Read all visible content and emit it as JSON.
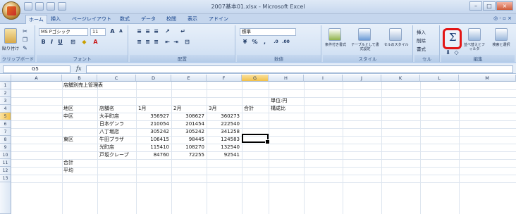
{
  "window": {
    "title": "2007基本01.xlsx - Microsoft Excel",
    "controls": [
      "–",
      "□",
      "×"
    ]
  },
  "ribbon_tabs": [
    "ホーム",
    "挿入",
    "ページレイアウト",
    "数式",
    "データ",
    "校閲",
    "表示",
    "アドイン"
  ],
  "ribbon_tabs_right": "◎ - ▫ ×",
  "ribbon": {
    "clipboard": {
      "paste_label": "貼り付け",
      "group_label": "クリップボード"
    },
    "font": {
      "font_name": "MS Pゴシック",
      "font_size": "11",
      "group_label": "フォント"
    },
    "alignment": {
      "group_label": "配置"
    },
    "number": {
      "format": "標準",
      "group_label": "数値"
    },
    "styles": {
      "conditional": "条件付き書式",
      "table": "テーブルとして書式設定",
      "cell_styles": "セルのスタイル",
      "group_label": "スタイル"
    },
    "cells": {
      "insert": "挿入",
      "delete": "削除",
      "format": "書式",
      "group_label": "セル"
    },
    "editing": {
      "autosum": "Σ",
      "sort": "並べ替えとフィルタ",
      "find": "検索と選択",
      "group_label": "編集"
    }
  },
  "formula_bar": {
    "name_box": "G5",
    "fx": "fx",
    "formula": ""
  },
  "sheet": {
    "columns": [
      "A",
      "B",
      "C",
      "D",
      "E",
      "F",
      "G",
      "H",
      "I",
      "J",
      "K",
      "L",
      "M"
    ],
    "selected_column": "G",
    "rows": [
      "1",
      "2",
      "3",
      "4",
      "5",
      "6",
      "7",
      "8",
      "9",
      "10",
      "11",
      "12",
      "13"
    ],
    "selected_row": "5",
    "title": "店舗別売上管理表",
    "unit_label": "単位:円",
    "headers": {
      "area": "地区",
      "store": "店舗名",
      "m1": "1月",
      "m2": "2月",
      "m3": "3月",
      "total": "合計",
      "ratio": "構成比"
    },
    "data_rows": [
      {
        "area": "中区",
        "store": "大手町店",
        "m1": "356927",
        "m2": "308627",
        "m3": "360273"
      },
      {
        "area": "",
        "store": "日本ゲンラ",
        "m1": "210054",
        "m2": "201454",
        "m3": "222540"
      },
      {
        "area": "",
        "store": "八丁堀店",
        "m1": "305242",
        "m2": "305242",
        "m3": "341258"
      },
      {
        "area": "東区",
        "store": "牛田プラザ",
        "m1": "106415",
        "m2": "98445",
        "m3": "124583"
      },
      {
        "area": "",
        "store": "光町店",
        "m1": "115410",
        "m2": "108270",
        "m3": "132540"
      },
      {
        "area": "",
        "store": "戸坂クレープ",
        "m1": "84760",
        "m2": "72255",
        "m3": "92541"
      }
    ],
    "total_label": "合計",
    "average_label": "平均"
  }
}
